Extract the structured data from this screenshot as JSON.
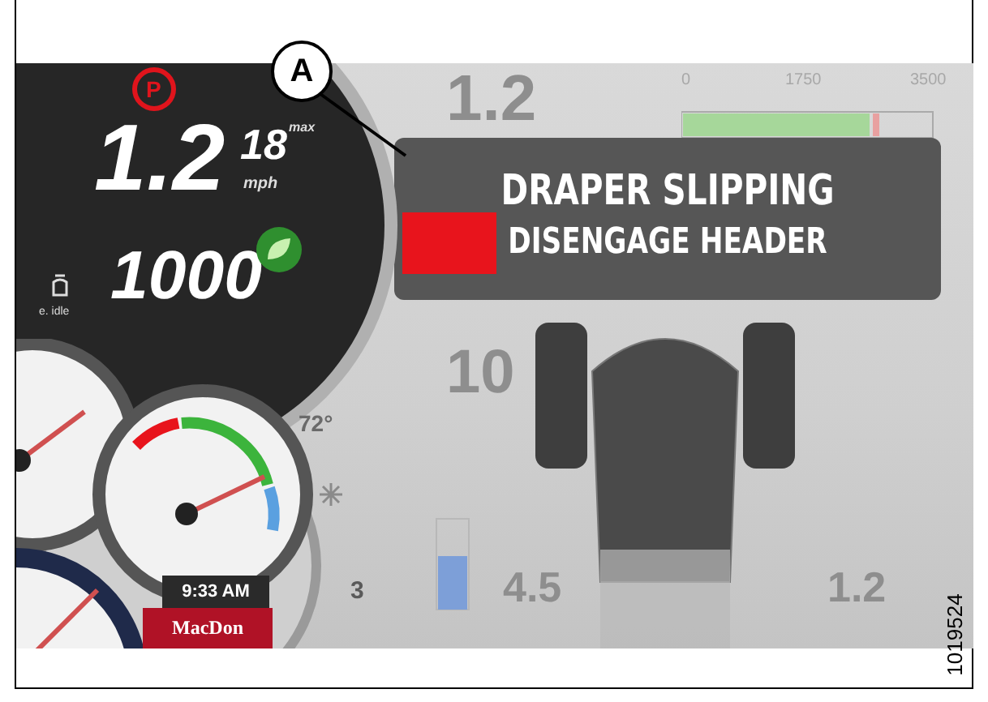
{
  "callout": {
    "label": "A"
  },
  "dial": {
    "parking": "P",
    "speed": "1.2",
    "max_speed": "18",
    "max_label": "max",
    "unit": "mph",
    "rpm": "1000",
    "rpm_label": "e. idle"
  },
  "gauges": {
    "temperature": "72°",
    "time": "9:33 AM",
    "brand": "MacDon",
    "gear": "3"
  },
  "background": {
    "speed": "1.2",
    "scale": [
      "0",
      "1750",
      "3500"
    ],
    "reading_1": "10",
    "reading_2": "4.5",
    "reading_3": "1.2"
  },
  "alert": {
    "lines": [
      "DRAPER SLIPPING",
      "DISENGAGE HEADER"
    ]
  },
  "figure_number": "1019524"
}
